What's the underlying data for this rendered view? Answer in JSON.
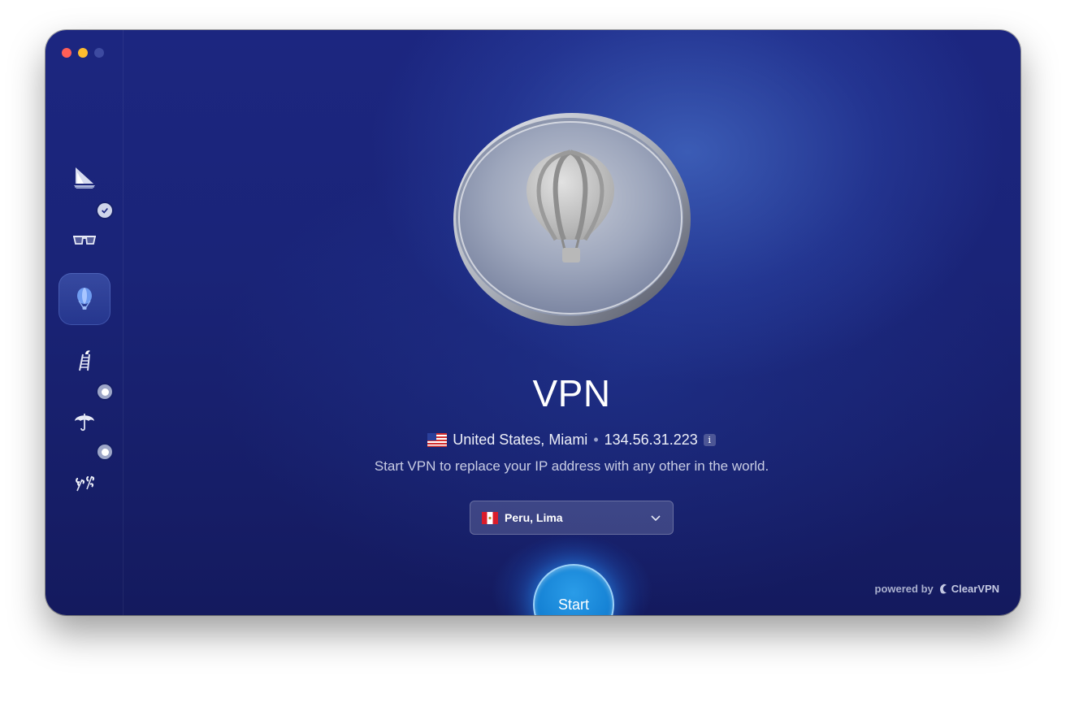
{
  "window": {
    "controls": [
      "close",
      "minimize",
      "zoom"
    ]
  },
  "sidebar": {
    "items": [
      {
        "id": "sailboat",
        "icon": "sailboat-icon",
        "active": false,
        "badge": null
      },
      {
        "id": "glasses",
        "icon": "glasses-icon",
        "active": false,
        "badge": "check"
      },
      {
        "id": "vpn",
        "icon": "balloon-icon",
        "active": true,
        "badge": null
      },
      {
        "id": "ladder",
        "icon": "ladder-icon",
        "active": false,
        "badge": null
      },
      {
        "id": "umbrella",
        "icon": "umbrella-icon",
        "active": false,
        "badge": "dot"
      },
      {
        "id": "leaves",
        "icon": "leaves-icon",
        "active": false,
        "badge": "dot"
      }
    ]
  },
  "main": {
    "title": "VPN",
    "current_location": "United States, Miami",
    "separator": "•",
    "ip_address": "134.56.31.223",
    "info_icon": "i",
    "description": "Start VPN to replace your IP address with any other in the world.",
    "location_select": {
      "value": "Peru, Lima",
      "flag": "peru-flag"
    },
    "start_label": "Start"
  },
  "footer": {
    "powered_by": "powered by",
    "brand": "ClearVPN"
  },
  "colors": {
    "background_top": "#1c2680",
    "background_bottom": "#141a5e",
    "start_button": "#1784d6",
    "traffic_red": "#ff5f57",
    "traffic_yellow": "#febc2e"
  }
}
